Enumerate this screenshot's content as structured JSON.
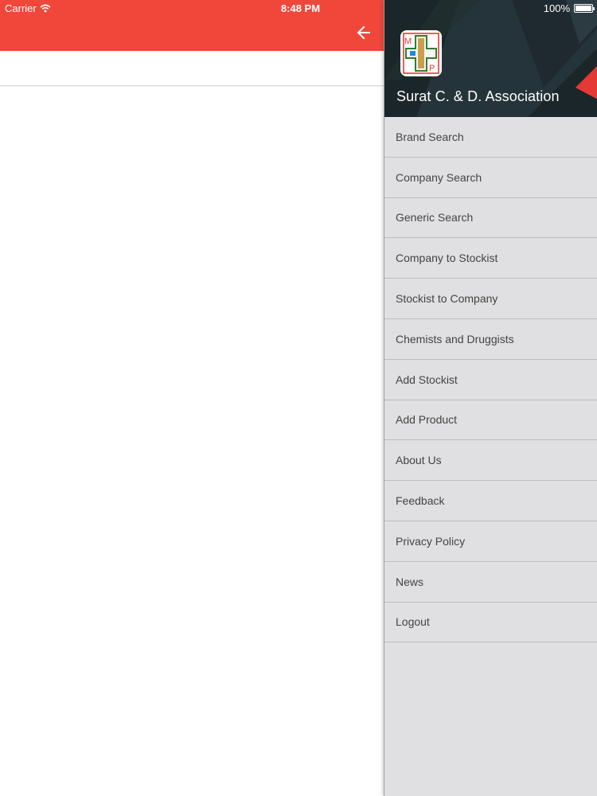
{
  "status_bar": {
    "carrier": "Carrier",
    "time": "8:48 PM",
    "battery": "100%"
  },
  "app": {
    "primary_color": "#f0473a",
    "back_icon": "arrow-left-icon"
  },
  "drawer": {
    "title": "Surat C. & D. Association",
    "header_color": "#1b262b",
    "logo_letters": {
      "top": "M",
      "bottom": "P"
    },
    "items": [
      {
        "label": "Brand Search"
      },
      {
        "label": "Company Search"
      },
      {
        "label": "Generic Search"
      },
      {
        "label": "Company to Stockist"
      },
      {
        "label": "Stockist to Company"
      },
      {
        "label": "Chemists and Druggists"
      },
      {
        "label": "Add Stockist"
      },
      {
        "label": "Add Product"
      },
      {
        "label": "About Us"
      },
      {
        "label": "Feedback"
      },
      {
        "label": "Privacy Policy"
      },
      {
        "label": "News"
      },
      {
        "label": "Logout"
      }
    ]
  }
}
